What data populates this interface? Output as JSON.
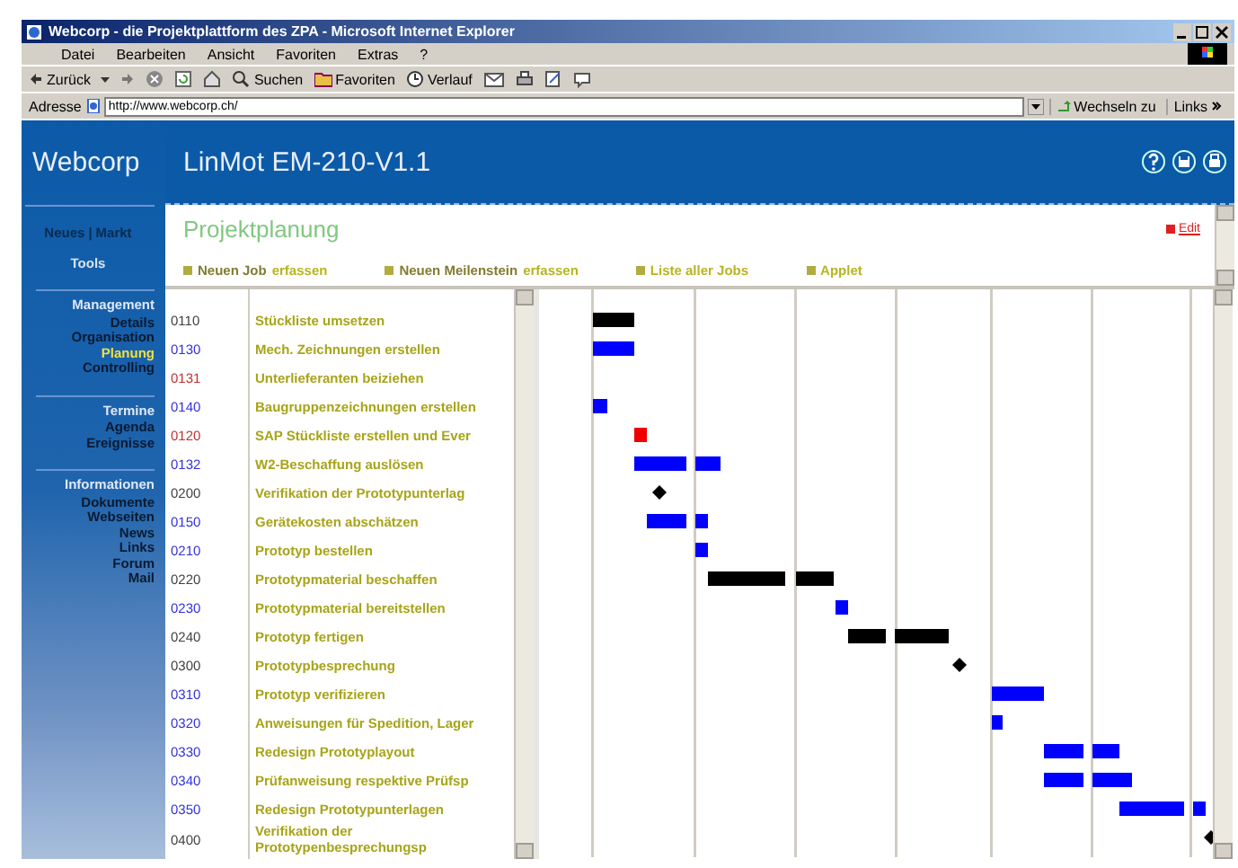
{
  "window": {
    "title": "Webcorp - die Projektplattform des ZPA - Microsoft Internet Explorer"
  },
  "menu": [
    "Datei",
    "Bearbeiten",
    "Ansicht",
    "Favoriten",
    "Extras",
    "?"
  ],
  "toolbar": {
    "back": "Zurück",
    "search": "Suchen",
    "favorites": "Favoriten",
    "history": "Verlauf"
  },
  "address_bar": {
    "label": "Adresse",
    "value": "http://www.webcorp.ch/",
    "go": "Wechseln zu",
    "links": "Links"
  },
  "site": {
    "logo": "Webcorp",
    "project": "LinMot EM-210-V1.1"
  },
  "sidebar": {
    "top_links": [
      "Neues",
      "Markt"
    ],
    "separator": "|",
    "tools": "Tools",
    "sections": [
      {
        "title": "Management",
        "items": [
          {
            "label": "Details",
            "selected": false
          },
          {
            "label": "Organisation",
            "selected": false
          },
          {
            "label": "Planung",
            "selected": true
          },
          {
            "label": "Controlling",
            "selected": false
          }
        ]
      },
      {
        "title": "Termine",
        "items": [
          {
            "label": "Agenda",
            "selected": false
          },
          {
            "label": "Ereignisse",
            "selected": false
          }
        ]
      },
      {
        "title": "Informationen",
        "items": [
          {
            "label": "Dokumente",
            "selected": false
          },
          {
            "label": "Webseiten",
            "selected": false
          },
          {
            "label": "News",
            "selected": false
          },
          {
            "label": "Links",
            "selected": false
          },
          {
            "label": "Forum",
            "selected": false
          },
          {
            "label": "Mail",
            "selected": false
          }
        ]
      }
    ]
  },
  "content": {
    "title": "Projektplanung",
    "edit": "Edit",
    "actions": [
      {
        "label": "Neuen Job",
        "link": "erfassen"
      },
      {
        "label": "Neuen Meilenstein",
        "link": "erfassen"
      },
      {
        "link": "Liste aller Jobs"
      },
      {
        "link": "Applet"
      }
    ]
  },
  "jobs": [
    {
      "id": "0110",
      "name": "Stückliste umsetzen",
      "color": "#404040"
    },
    {
      "id": "0130",
      "name": "Mech. Zeichnungen erstellen",
      "color": "#3030e0"
    },
    {
      "id": "0131",
      "name": "Unterlieferanten beiziehen",
      "color": "#c03030"
    },
    {
      "id": "0140",
      "name": "Baugruppenzeichnungen erstellen",
      "color": "#3030e0"
    },
    {
      "id": "0120",
      "name": "SAP Stückliste erstellen und Ever",
      "color": "#c03030"
    },
    {
      "id": "0132",
      "name": "W2-Beschaffung auslösen",
      "color": "#3030e0"
    },
    {
      "id": "0200",
      "name": "Verifikation der Prototypunterlag",
      "color": "#404040"
    },
    {
      "id": "0150",
      "name": "Gerätekosten abschätzen",
      "color": "#3030e0"
    },
    {
      "id": "0210",
      "name": "Prototyp bestellen",
      "color": "#3030e0"
    },
    {
      "id": "0220",
      "name": "Prototypmaterial beschaffen",
      "color": "#404040"
    },
    {
      "id": "0230",
      "name": "Prototypmaterial bereitstellen",
      "color": "#3030e0"
    },
    {
      "id": "0240",
      "name": "Prototyp fertigen",
      "color": "#404040"
    },
    {
      "id": "0300",
      "name": "Prototypbesprechung",
      "color": "#404040"
    },
    {
      "id": "0310",
      "name": "Prototyp verifizieren",
      "color": "#3030e0"
    },
    {
      "id": "0320",
      "name": "Anweisungen für Spedition, Lager",
      "color": "#3030e0"
    },
    {
      "id": "0330",
      "name": "Redesign Prototyplayout",
      "color": "#3030e0"
    },
    {
      "id": "0340",
      "name": "Prüfanweisung respektive Prüfsp",
      "color": "#3030e0"
    },
    {
      "id": "0350",
      "name": "Redesign Prototypunterlagen",
      "color": "#3030e0"
    },
    {
      "id": "0400",
      "name": "Verifikation der Prototypenbesprechungsp",
      "color": "#404040"
    }
  ]
}
